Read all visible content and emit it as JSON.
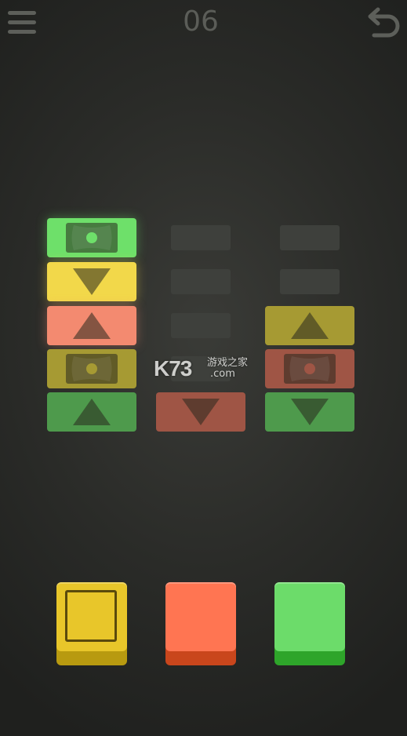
{
  "header": {
    "level": "06",
    "menu_icon": "hamburger-menu-icon",
    "undo_icon": "undo-arrow-icon"
  },
  "colors": {
    "green": "#6ee06a",
    "yellow": "#f2d84a",
    "red": "#f38a70",
    "dim_yellow": "#a69a33",
    "dim_red": "#9f5545",
    "dim_green": "#4e9a4c",
    "empty": "#3e403c"
  },
  "columns": [
    {
      "slots": [
        {
          "state": "filled",
          "color": "green",
          "glyph": "dot",
          "lit": true
        },
        {
          "state": "filled",
          "color": "yellow",
          "glyph": "arrow-down",
          "lit": true
        },
        {
          "state": "filled",
          "color": "red",
          "glyph": "arrow-up",
          "lit": true
        },
        {
          "state": "filled",
          "color": "yellow",
          "glyph": "dot",
          "lit": false
        },
        {
          "state": "filled",
          "color": "green",
          "glyph": "arrow-up",
          "lit": false
        }
      ]
    },
    {
      "slots": [
        {
          "state": "empty"
        },
        {
          "state": "empty"
        },
        {
          "state": "empty"
        },
        {
          "state": "empty"
        },
        {
          "state": "filled",
          "color": "red",
          "glyph": "arrow-down",
          "lit": false
        }
      ]
    },
    {
      "slots": [
        {
          "state": "empty"
        },
        {
          "state": "empty"
        },
        {
          "state": "filled",
          "color": "yellow",
          "glyph": "arrow-up",
          "lit": false
        },
        {
          "state": "filled",
          "color": "red",
          "glyph": "dot",
          "lit": false
        },
        {
          "state": "filled",
          "color": "green",
          "glyph": "arrow-down",
          "lit": false
        }
      ]
    }
  ],
  "watermark": {
    "brand": "K73",
    "site_cn": "游戏之家",
    "domain": ".com"
  },
  "buttons": [
    {
      "color": "yellow",
      "face": "#e8c62a",
      "base": "#b89a10",
      "selected": true
    },
    {
      "color": "red",
      "face": "#ff7552",
      "base": "#c9461c",
      "selected": false
    },
    {
      "color": "green",
      "face": "#6cdc6a",
      "base": "#2ea52a",
      "selected": false
    }
  ]
}
